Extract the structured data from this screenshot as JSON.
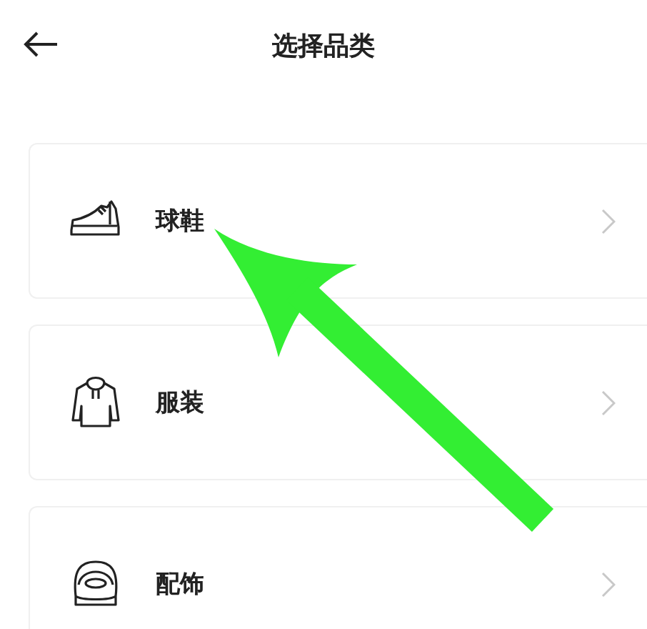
{
  "header": {
    "title": "选择品类"
  },
  "categories": [
    {
      "kind": "shoe",
      "label": "球鞋"
    },
    {
      "kind": "hoodie",
      "label": "服装"
    },
    {
      "kind": "cap",
      "label": "配饰"
    }
  ]
}
